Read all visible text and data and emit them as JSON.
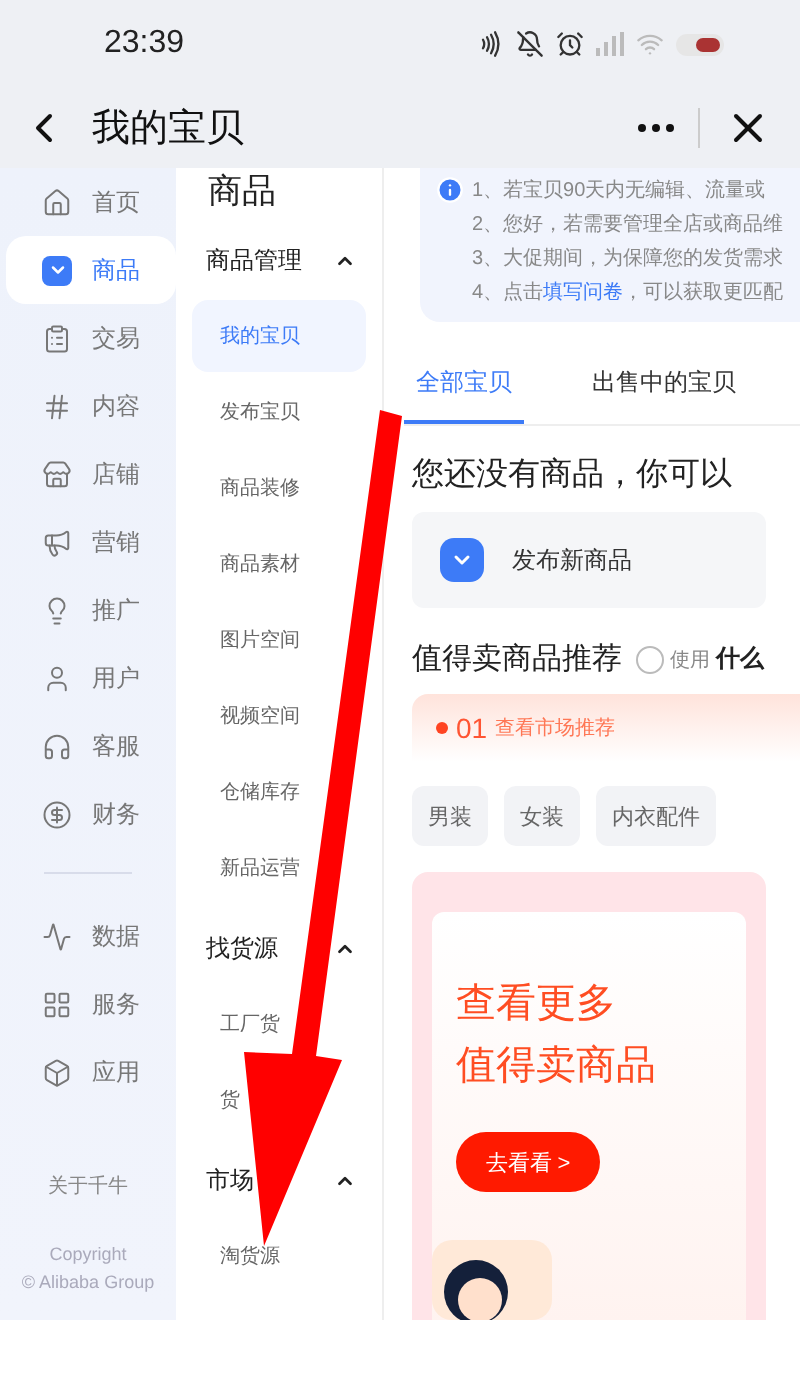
{
  "status_bar": {
    "time": "23:39"
  },
  "header": {
    "title": "我的宝贝"
  },
  "sidebar": {
    "groups": [
      {
        "items": [
          {
            "label": "首页",
            "selected": false
          },
          {
            "label": "商品",
            "selected": true
          },
          {
            "label": "交易",
            "selected": false
          },
          {
            "label": "内容",
            "selected": false
          },
          {
            "label": "店铺",
            "selected": false
          },
          {
            "label": "营销",
            "selected": false
          },
          {
            "label": "推广",
            "selected": false
          },
          {
            "label": "用户",
            "selected": false
          },
          {
            "label": "客服",
            "selected": false
          },
          {
            "label": "财务",
            "selected": false
          }
        ]
      },
      {
        "items": [
          {
            "label": "数据",
            "selected": false
          },
          {
            "label": "服务",
            "selected": false
          },
          {
            "label": "应用",
            "selected": false
          }
        ]
      }
    ],
    "footer": {
      "about": "关于千牛",
      "copyright": "Copyright",
      "company": "© Alibaba Group"
    }
  },
  "nav": {
    "title": "商品",
    "groups": [
      {
        "title": "商品管理",
        "expanded": true,
        "items": [
          {
            "label": "我的宝贝",
            "selected": true
          },
          {
            "label": "发布宝贝",
            "selected": false
          },
          {
            "label": "商品装修",
            "selected": false
          },
          {
            "label": "商品素材",
            "selected": false
          },
          {
            "label": "图片空间",
            "selected": false
          },
          {
            "label": "视频空间",
            "selected": false
          },
          {
            "label": "仓储库存",
            "selected": false
          },
          {
            "label": "新品运营",
            "selected": false
          }
        ]
      },
      {
        "title": "找货源",
        "expanded": true,
        "items": [
          {
            "label": "工厂货",
            "selected": false
          },
          {
            "label": "货",
            "selected": false
          }
        ]
      },
      {
        "title": "市场",
        "expanded": true,
        "items": [
          {
            "label": "淘货源",
            "selected": false
          }
        ]
      }
    ]
  },
  "notice": {
    "lines": [
      {
        "text": "1、若宝贝90天内无编辑、流量或"
      },
      {
        "text": "2、您好，若需要管理全店或商品维"
      },
      {
        "text": "3、大促期间，为保障您的发货需求"
      },
      {
        "text": "4、点击",
        "link": "填写问卷",
        "after": "，可以获取更匹配"
      }
    ]
  },
  "tabs": [
    {
      "label": "全部宝贝",
      "selected": true
    },
    {
      "label": "出售中的宝贝",
      "selected": false
    }
  ],
  "empty": {
    "heading": "您还没有商品，你可以",
    "action": "发布新商品"
  },
  "recommend": {
    "title": "值得卖商品推荐",
    "checkbox": {
      "checked": false,
      "label": "使用",
      "suffix": "什么"
    },
    "step": {
      "number": "01",
      "label": "查看市场推荐"
    },
    "categories": [
      "男装",
      "女装",
      "内衣配件"
    ],
    "promo": {
      "line1": "查看更多",
      "line2": "值得卖商品",
      "button": "去看看 >"
    }
  }
}
